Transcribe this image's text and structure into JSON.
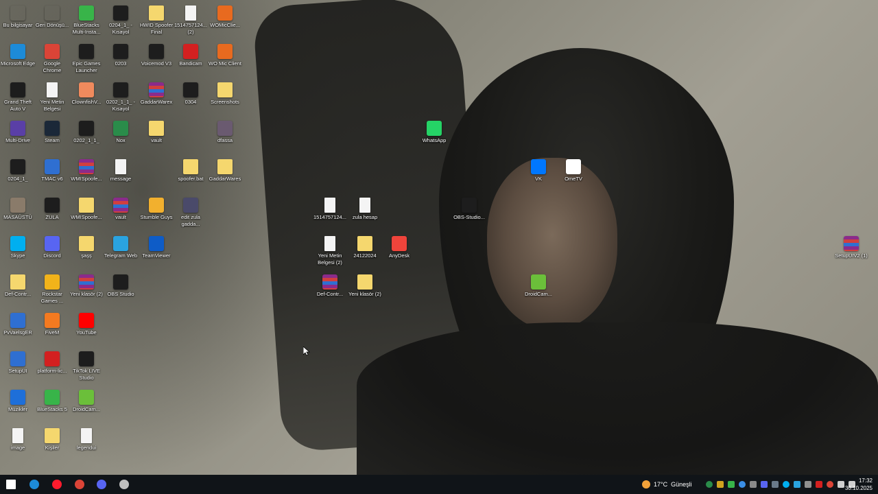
{
  "desktop": {
    "icons": [
      {
        "label": "Bu bilgisayar",
        "icon": "computer-icon",
        "kind": "sys",
        "color": "#3a8ee6"
      },
      {
        "label": "Geri Dönüşü...",
        "icon": "recycle-bin-icon",
        "kind": "sys",
        "color": "#9aa7b5"
      },
      {
        "label": "BlueStacks Multi-Insta...",
        "icon": "bluestacks-icon",
        "kind": "app",
        "color": "#38b449"
      },
      {
        "label": "0204_1_ - Kısayol",
        "icon": "shortcut-icon",
        "kind": "dark",
        "color": "#1d1d1d"
      },
      {
        "label": "HWID Spoofer Final",
        "icon": "folder-icon",
        "kind": "folder",
        "color": "#f5d76e"
      },
      {
        "label": "1514757124... (2)",
        "icon": "file-icon",
        "kind": "file",
        "color": "#f4f4f4"
      },
      {
        "label": "WOMicClie...",
        "icon": "mic-icon",
        "kind": "app",
        "color": "#e86a1f"
      },
      {
        "label": "Microsoft Edge",
        "icon": "edge-icon",
        "kind": "app",
        "color": "#1d8bd8"
      },
      {
        "label": "Google Chrome",
        "icon": "chrome-icon",
        "kind": "app",
        "color": "#db4437"
      },
      {
        "label": "Epic Games Launcher",
        "icon": "epic-icon",
        "kind": "dark",
        "color": "#1d1d1d"
      },
      {
        "label": "0203",
        "icon": "shortcut-icon",
        "kind": "dark",
        "color": "#1d1d1d"
      },
      {
        "label": "Voicemod V3",
        "icon": "voicemod-icon",
        "kind": "dark",
        "color": "#1d1d1d"
      },
      {
        "label": "Bandicam",
        "icon": "bandicam-icon",
        "kind": "app",
        "color": "#d32020"
      },
      {
        "label": "WO Mic Client",
        "icon": "mic-icon",
        "kind": "app",
        "color": "#e86a1f"
      },
      {
        "label": "Grand Theft Auto V",
        "icon": "gta-icon",
        "kind": "dark",
        "color": "#333333"
      },
      {
        "label": "Yeni Metin Belgesi",
        "icon": "file-icon",
        "kind": "file",
        "color": "#f4f4f4"
      },
      {
        "label": "ClownfishV...",
        "icon": "clownfish-icon",
        "kind": "app",
        "color": "#f08a5d"
      },
      {
        "label": "0202_1_1_ - Kısayol",
        "icon": "shortcut-icon",
        "kind": "dark",
        "color": "#1d1d1d"
      },
      {
        "label": "GaddarWarex",
        "icon": "rar-icon",
        "kind": "rar",
        "color": "#8b2b8b"
      },
      {
        "label": "0304",
        "icon": "shortcut-icon",
        "kind": "dark",
        "color": "#1d1d1d"
      },
      {
        "label": "Screenshots",
        "icon": "folder-icon",
        "kind": "folder",
        "color": "#f5d76e"
      },
      {
        "label": "Multi-Drive",
        "icon": "multidrive-icon",
        "kind": "app",
        "color": "#5a3fa6"
      },
      {
        "label": "Steam",
        "icon": "steam-icon",
        "kind": "app",
        "color": "#1b2838"
      },
      {
        "label": "0202_1_1_",
        "icon": "shortcut-icon",
        "kind": "dark",
        "color": "#333333"
      },
      {
        "label": "Nox",
        "icon": "nox-icon",
        "kind": "app",
        "color": "#2a8c4a"
      },
      {
        "label": "vault",
        "icon": "folder-icon",
        "kind": "folder",
        "color": "#f5d76e"
      },
      {
        "label": "dfassa",
        "icon": "image-icon",
        "kind": "app",
        "color": "#6a5a70"
      },
      {
        "label": "0204_1_",
        "icon": "shortcut-icon",
        "kind": "dark",
        "color": "#1d1d1d"
      },
      {
        "label": "TMAC v6",
        "icon": "tmac-icon",
        "kind": "app",
        "color": "#2f6fd1"
      },
      {
        "label": "WMISpoofe...",
        "icon": "rar-icon",
        "kind": "rar",
        "color": "#8b2b8b"
      },
      {
        "label": "message",
        "icon": "file-icon",
        "kind": "file",
        "color": "#f4f4f4"
      },
      {
        "label": "spoofer.bat",
        "icon": "bat-icon",
        "kind": "folder",
        "color": "#f5d76e"
      },
      {
        "label": "GaddarWares",
        "icon": "folder-icon",
        "kind": "folder",
        "color": "#f5d76e"
      },
      {
        "label": "MASAÜSTÜ",
        "icon": "image-icon",
        "kind": "app",
        "color": "#8a7b6a"
      },
      {
        "label": "ZULA",
        "icon": "zula-icon",
        "kind": "dark",
        "color": "#222222"
      },
      {
        "label": "WMISpoofe...",
        "icon": "folder-icon",
        "kind": "folder",
        "color": "#f5d76e"
      },
      {
        "label": "vault",
        "icon": "rar-icon",
        "kind": "rar",
        "color": "#8b2b8b"
      },
      {
        "label": "Stumble Guys",
        "icon": "stumble-icon",
        "kind": "app",
        "color": "#f2b02e"
      },
      {
        "label": "edit zula gadda...",
        "icon": "image-icon",
        "kind": "app",
        "color": "#4a4a6a"
      },
      {
        "label": "Skype",
        "icon": "skype-icon",
        "kind": "app",
        "color": "#00aff0"
      },
      {
        "label": "Discord",
        "icon": "discord-icon",
        "kind": "app",
        "color": "#5865f2"
      },
      {
        "label": "şaşş",
        "icon": "folder-icon",
        "kind": "folder",
        "color": "#f5d76e"
      },
      {
        "label": "Telegram Web",
        "icon": "telegram-icon",
        "kind": "app",
        "color": "#2aa3e0"
      },
      {
        "label": "TeamViewer",
        "icon": "teamviewer-icon",
        "kind": "app",
        "color": "#0e5cc7"
      },
      {
        "label": "Def-Contr...",
        "icon": "folder-icon",
        "kind": "folder",
        "color": "#f5d76e"
      },
      {
        "label": "Rockstar Games ...",
        "icon": "rockstar-icon",
        "kind": "app",
        "color": "#f2b31a"
      },
      {
        "label": "Yeni klasör (2)",
        "icon": "rar-icon",
        "kind": "rar",
        "color": "#8b2b8b"
      },
      {
        "label": "OBS Studio",
        "icon": "obs-icon",
        "kind": "dark",
        "color": "#302e31"
      },
      {
        "label": "PvVaelsgER",
        "icon": "window-icon",
        "kind": "app",
        "color": "#2f6fd1"
      },
      {
        "label": "FiveM",
        "icon": "fivem-icon",
        "kind": "app",
        "color": "#f47a20"
      },
      {
        "label": "YouTube",
        "icon": "youtube-icon",
        "kind": "app",
        "color": "#ff0000"
      },
      {
        "label": "SetupUI",
        "icon": "window-icon",
        "kind": "app",
        "color": "#2f6fd1"
      },
      {
        "label": "platform-lic...",
        "icon": "pdf-icon",
        "kind": "app",
        "color": "#d32020"
      },
      {
        "label": "TikTok LIVE Studio",
        "icon": "tiktok-icon",
        "kind": "dark",
        "color": "#111111"
      },
      {
        "label": "Müzikler",
        "icon": "music-icon",
        "kind": "app",
        "color": "#1e6fd9"
      },
      {
        "label": "BlueStacks 5",
        "icon": "bluestacks-icon",
        "kind": "app",
        "color": "#38b449"
      },
      {
        "label": "DroidCam...",
        "icon": "droidcam-icon",
        "kind": "app",
        "color": "#6bbf3a"
      },
      {
        "label": "image",
        "icon": "image-icon",
        "kind": "file",
        "color": "#f4f4f4"
      },
      {
        "label": "Kişiler",
        "icon": "contacts-icon",
        "kind": "folder",
        "color": "#f5d76e"
      },
      {
        "label": "legendui",
        "icon": "file-icon",
        "kind": "file",
        "color": "#f4f4f4"
      },
      {
        "label": "WhatsApp",
        "icon": "whatsapp-icon",
        "kind": "app",
        "color": "#25d366"
      },
      {
        "label": "VK",
        "icon": "vk-icon",
        "kind": "app",
        "color": "#0077ff"
      },
      {
        "label": "OmeTV",
        "icon": "ometv-icon",
        "kind": "app",
        "color": "#ffffff"
      },
      {
        "label": "1514757124...",
        "icon": "file-icon",
        "kind": "file",
        "color": "#f4f4f4"
      },
      {
        "label": "zula hesap",
        "icon": "file-icon",
        "kind": "file",
        "color": "#f4f4f4"
      },
      {
        "label": "OBS-Studio...",
        "icon": "obs-icon",
        "kind": "dark",
        "color": "#302e31"
      },
      {
        "label": "Yeni Metin Belgesi (2)",
        "icon": "file-icon",
        "kind": "file",
        "color": "#f4f4f4"
      },
      {
        "label": "24122024",
        "icon": "folder-icon",
        "kind": "folder",
        "color": "#f5d76e"
      },
      {
        "label": "AnyDesk",
        "icon": "anydesk-icon",
        "kind": "app",
        "color": "#ef443b"
      },
      {
        "label": "Def-Contr...",
        "icon": "rar-icon",
        "kind": "rar",
        "color": "#8b2b8b"
      },
      {
        "label": "Yeni klasör (2)",
        "icon": "folder-icon",
        "kind": "folder",
        "color": "#f5d76e"
      },
      {
        "label": "DroidCam...",
        "icon": "droidcam-icon",
        "kind": "app",
        "color": "#6bbf3a"
      },
      {
        "label": "SetupUIV2 (1)",
        "icon": "rar-icon",
        "kind": "rar",
        "color": "#8b2b8b"
      }
    ]
  },
  "taskbar": {
    "items": [
      {
        "name": "start-button",
        "icon": "windows-icon",
        "color": "#ffffff"
      },
      {
        "name": "taskbar-edge",
        "icon": "edge-icon",
        "color": "#1d8bd8"
      },
      {
        "name": "taskbar-opera",
        "icon": "opera-icon",
        "color": "#ff1b2d"
      },
      {
        "name": "taskbar-chrome",
        "icon": "chrome-icon",
        "color": "#db4437"
      },
      {
        "name": "taskbar-discord",
        "icon": "discord-icon",
        "color": "#5865f2"
      },
      {
        "name": "taskbar-obs",
        "icon": "obs-icon",
        "color": "#bfbfbf"
      }
    ],
    "weather": {
      "temp": "17°C",
      "condition": "Güneşli"
    },
    "clock": {
      "time": "17:32",
      "date": "30.10.2025"
    }
  }
}
